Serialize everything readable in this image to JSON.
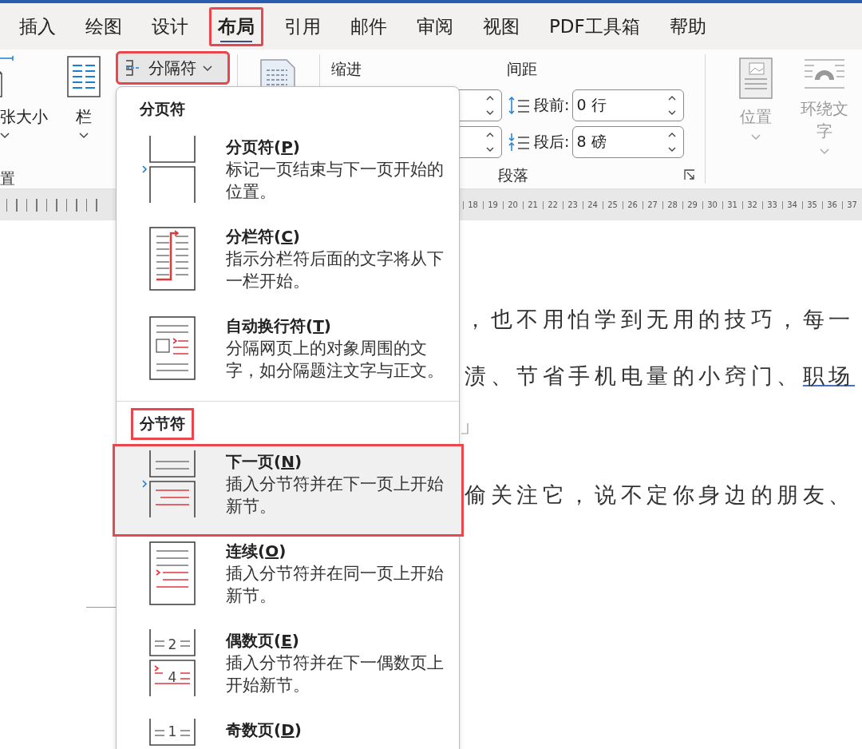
{
  "tabs": [
    {
      "label": "插入",
      "selected": false,
      "annotated": false
    },
    {
      "label": "绘图",
      "selected": false,
      "annotated": false
    },
    {
      "label": "设计",
      "selected": false,
      "annotated": false
    },
    {
      "label": "布局",
      "selected": true,
      "annotated": true
    },
    {
      "label": "引用",
      "selected": false,
      "annotated": false
    },
    {
      "label": "邮件",
      "selected": false,
      "annotated": false
    },
    {
      "label": "审阅",
      "selected": false,
      "annotated": false
    },
    {
      "label": "视图",
      "selected": false,
      "annotated": false
    },
    {
      "label": "PDF工具箱",
      "selected": false,
      "annotated": false
    },
    {
      "label": "帮助",
      "selected": false,
      "annotated": false
    }
  ],
  "ribbon": {
    "page_setup": {
      "buttons": [
        {
          "label": "张大小"
        },
        {
          "label": "栏"
        }
      ],
      "group_label": "置"
    },
    "breaks_button": {
      "label": "分隔符",
      "pressed": true,
      "annotated": true
    },
    "paragraph": {
      "indent": {
        "label": "缩进",
        "fields": [
          {
            "kind": "spin"
          },
          {
            "kind": "spin"
          }
        ]
      },
      "spacing": {
        "label": "间距",
        "fields": [
          {
            "kind": "before",
            "label": "段前:",
            "value": "0 行"
          },
          {
            "kind": "after",
            "label": "段后:",
            "value": "8 磅"
          }
        ]
      },
      "group_label": "段落"
    },
    "arrange": {
      "buttons": [
        {
          "label": "位置",
          "disabled": true
        },
        {
          "label": "环绕文字",
          "disabled": true
        }
      ]
    }
  },
  "ruler": {
    "numbers": [
      "18",
      "19",
      "20",
      "21",
      "22",
      "23",
      "24",
      "25",
      "26",
      "27",
      "28",
      "29",
      "30",
      "31",
      "32",
      "33",
      "34",
      "35",
      "36",
      "37"
    ]
  },
  "document": {
    "lines": [
      {
        "kind": "text",
        "segments": [
          {
            "text": "，也不用怕学到无用的技巧，每一",
            "underlined": false
          }
        ]
      },
      {
        "kind": "text",
        "segments": [
          {
            "text": "渍、节省手机电量的小窍门、",
            "underlined": false
          },
          {
            "text": "职场",
            "underlined": true
          }
        ]
      },
      {
        "kind": "mark"
      },
      {
        "kind": "text",
        "segments": [
          {
            "text": "偷关注它，说不定你身边的朋友、",
            "underlined": false
          }
        ]
      }
    ]
  },
  "menu": {
    "sections": [
      {
        "title": "分页符",
        "annotated": false,
        "items": [
          {
            "kind": "page-break",
            "label": "分页符(",
            "access_key": "P",
            "tail": ")",
            "description": "标记一页结束与下一页开始的位置。",
            "selected": false,
            "annotated": false
          },
          {
            "kind": "column-break",
            "label": "分栏符(",
            "access_key": "C",
            "tail": ")",
            "description": "指示分栏符后面的文字将从下一栏开始。",
            "selected": false,
            "annotated": false
          },
          {
            "kind": "text-wrapping",
            "label": "自动换行符(",
            "access_key": "T",
            "tail": ")",
            "description": "分隔网页上的对象周围的文字，如分隔题注文字与正文。",
            "selected": false,
            "annotated": false
          }
        ]
      },
      {
        "title": "分节符",
        "annotated": true,
        "items": [
          {
            "kind": "next-page",
            "label": "下一页(",
            "access_key": "N",
            "tail": ")",
            "description": "插入分节符并在下一页上开始新节。",
            "selected": true,
            "annotated": true
          },
          {
            "kind": "continuous",
            "label": "连续(",
            "access_key": "O",
            "tail": ")",
            "description": "插入分节符并在同一页上开始新节。",
            "selected": false,
            "annotated": false
          },
          {
            "kind": "even-page",
            "label": "偶数页(",
            "access_key": "E",
            "tail": ")",
            "description": "插入分节符并在下一偶数页上开始新节。",
            "icon_numbers": [
              "2",
              "4"
            ],
            "selected": false,
            "annotated": false
          },
          {
            "kind": "odd-page",
            "label": "奇数页(",
            "access_key": "D",
            "tail": ")",
            "icon_numbers": [
              "1"
            ],
            "selected": false,
            "annotated": false
          }
        ]
      }
    ]
  }
}
